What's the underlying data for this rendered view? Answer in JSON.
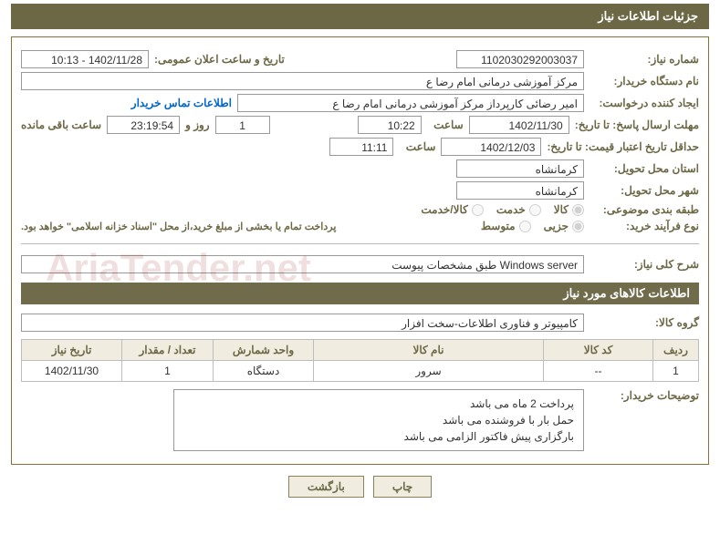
{
  "title": "جزئیات اطلاعات نیاز",
  "labels": {
    "need_no": "شماره نیاز:",
    "announce_dt": "تاریخ و ساعت اعلان عمومی:",
    "buyer_org": "نام دستگاه خریدار:",
    "requester": "ایجاد کننده درخواست:",
    "contact": "اطلاعات تماس خریدار",
    "reply_deadline": "مهلت ارسال پاسخ: تا تاریخ:",
    "time": "ساعت",
    "days_and": "روز و",
    "remain": "ساعت باقی مانده",
    "quote_validity": "حداقل تاریخ اعتبار قیمت: تا تاریخ:",
    "delivery_province": "استان محل تحویل:",
    "delivery_city": "شهر محل تحویل:",
    "category": "طبقه بندی موضوعی:",
    "purchase_type": "نوع فرآیند خرید:",
    "purchase_note": "پرداخت تمام یا بخشی از مبلغ خرید،از محل \"اسناد خزانه اسلامی\" خواهد بود.",
    "general_desc": "شرح کلی نیاز:",
    "goods_header": "اطلاعات کالاهای مورد نیاز",
    "goods_group": "گروه کالا:",
    "buyer_notes": "توضیحات خریدار:"
  },
  "values": {
    "need_no": "1102030292003037",
    "announce_dt": "1402/11/28 - 10:13",
    "buyer_org": "مرکز آموزشی  درمانی امام رضا  ع",
    "requester": "امیر رضائی کارپرداز مرکز آموزشی  درمانی امام رضا  ع",
    "reply_date": "1402/11/30",
    "reply_time": "10:22",
    "remain_days": "1",
    "remain_time": "23:19:54",
    "quote_date": "1402/12/03",
    "quote_time": "11:11",
    "province": "کرمانشاه",
    "city": "کرمانشاه",
    "general_desc": "Windows server طبق مشخصات پیوست",
    "goods_group": "کامپیوتر و فناوری اطلاعات-سخت افزار"
  },
  "radios_category": {
    "goods": "کالا",
    "service": "خدمت",
    "goods_service": "کالا/خدمت"
  },
  "radios_process": {
    "partial": "جزیی",
    "medium": "متوسط"
  },
  "table": {
    "headers": [
      "ردیف",
      "کد کالا",
      "نام کالا",
      "واحد شمارش",
      "تعداد / مقدار",
      "تاریخ نیاز"
    ],
    "rows": [
      {
        "i": "1",
        "code": "--",
        "name": "سرور",
        "unit": "دستگاه",
        "qty": "1",
        "date": "1402/11/30"
      }
    ]
  },
  "buyer_notes": [
    "پرداخت 2 ماه می باشد",
    "حمل بار با فروشنده می باشد",
    "بارگزاری پیش فاکتور الزامی می باشد"
  ],
  "buttons": {
    "print": "چاپ",
    "back": "بازگشت"
  },
  "watermark": "AriaTender.net"
}
